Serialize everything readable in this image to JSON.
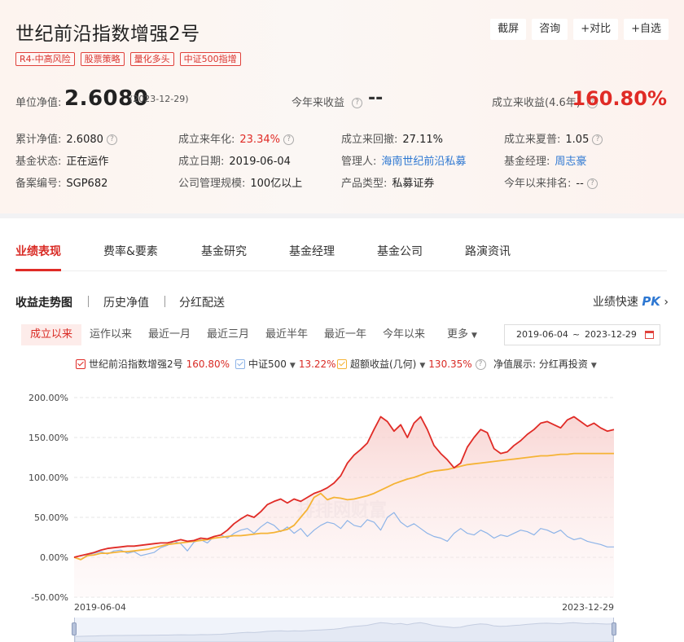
{
  "header": {
    "title": "世纪前沿指数增强2号",
    "tags": [
      "R4-中高风险",
      "股票策略",
      "量化多头",
      "中证500指增"
    ],
    "buttons": [
      "截屏",
      "咨询",
      "+对比",
      "+自选"
    ]
  },
  "summary": {
    "nav_label": "单位净值:",
    "nav_value": "2.6080",
    "nav_date": "(2023-12-29)",
    "ytd_label": "今年来收益",
    "ytd_value": "--",
    "since_label": "成立来收益(4.6年)",
    "since_value": "160.80%"
  },
  "details": {
    "row1": [
      {
        "label": "累计净值:",
        "value": "2.6080"
      },
      {
        "label": "成立来年化:",
        "value": "23.34%"
      },
      {
        "label": "成立来回撤:",
        "value": "27.11%"
      },
      {
        "label": "成立来夏普:",
        "value": "1.05"
      }
    ],
    "row2": [
      {
        "label": "基金状态:",
        "value": "正在运作"
      },
      {
        "label": "成立日期:",
        "value": "2019-06-04"
      },
      {
        "label": "管理人:",
        "value": "海南世纪前沿私募"
      },
      {
        "label": "基金经理:",
        "value": "周志豪"
      }
    ],
    "row3": [
      {
        "label": "备案编号:",
        "value": "SGP682"
      },
      {
        "label": "公司管理规模:",
        "value": "100亿以上"
      },
      {
        "label": "产品类型:",
        "value": "私募证券"
      },
      {
        "label": "今年以来排名:",
        "value": "--"
      }
    ]
  },
  "tabs": [
    "业绩表现",
    "费率&要素",
    "基金研究",
    "基金经理",
    "基金公司",
    "路演资讯"
  ],
  "subtabs": [
    "收益走势图",
    "历史净值",
    "分红配送"
  ],
  "quick_compare": {
    "label": "业绩快速",
    "pk": "PK"
  },
  "ranges": [
    "成立以来",
    "运作以来",
    "最近一月",
    "最近三月",
    "最近半年",
    "最近一年",
    "今年以来",
    "更多"
  ],
  "date_range": {
    "start": "2019-06-04",
    "sep": "~",
    "end": "2023-12-29"
  },
  "legend": {
    "items": [
      {
        "name": "世纪前沿指数增强2号",
        "value": "160.80%",
        "color": "#e02b26"
      },
      {
        "name": "中证500",
        "value": "13.22%",
        "color": "#8db4e8"
      },
      {
        "name": "超额收益(几何)",
        "value": "130.35%",
        "color": "#f5b335"
      }
    ],
    "display_label": "净值展示:",
    "display_value": "分红再投资"
  },
  "chart_data": {
    "type": "line",
    "x_start": "2019-06-04",
    "x_end": "2023-12-29",
    "x_ticks": [
      "2019-06-04",
      "2023-12-29"
    ],
    "y_ticks": [
      "200.00%",
      "150.00%",
      "100.00%",
      "50.00%",
      "0.00%",
      "-50.00%"
    ],
    "ylim": [
      -50,
      200
    ],
    "grid": true,
    "watermark": "排排网财富",
    "series": [
      {
        "name": "世纪前沿指数增强2号",
        "color": "#e02b26",
        "values": [
          0,
          2,
          4,
          6,
          9,
          11,
          12,
          13,
          14,
          14,
          15,
          16,
          17,
          18,
          18,
          20,
          22,
          20,
          21,
          24,
          23,
          26,
          28,
          34,
          42,
          48,
          53,
          50,
          57,
          66,
          70,
          73,
          68,
          73,
          70,
          75,
          80,
          83,
          87,
          93,
          102,
          118,
          128,
          135,
          143,
          160,
          176,
          170,
          158,
          166,
          150,
          168,
          176,
          160,
          140,
          130,
          122,
          112,
          118,
          138,
          150,
          160,
          156,
          136,
          130,
          132,
          140,
          146,
          154,
          160,
          168,
          170,
          166,
          162,
          172,
          176,
          170,
          164,
          168,
          162,
          158,
          160
        ]
      },
      {
        "name": "中证500",
        "color": "#8db4e8",
        "values": [
          0,
          -3,
          3,
          5,
          7,
          4,
          8,
          9,
          5,
          7,
          2,
          4,
          6,
          12,
          15,
          20,
          17,
          8,
          19,
          22,
          18,
          26,
          28,
          24,
          30,
          34,
          36,
          30,
          38,
          44,
          40,
          32,
          38,
          30,
          36,
          26,
          34,
          40,
          44,
          42,
          36,
          46,
          40,
          38,
          47,
          44,
          34,
          50,
          56,
          44,
          38,
          42,
          36,
          30,
          26,
          24,
          20,
          30,
          36,
          30,
          28,
          34,
          30,
          24,
          28,
          26,
          30,
          34,
          32,
          28,
          36,
          34,
          30,
          34,
          26,
          22,
          24,
          20,
          18,
          16,
          13,
          13
        ]
      },
      {
        "name": "超额收益(几何)",
        "color": "#f5b335",
        "values": [
          0,
          -3,
          2,
          3,
          5,
          5,
          6,
          7,
          7,
          8,
          9,
          10,
          12,
          14,
          16,
          17,
          18,
          19,
          20,
          21,
          22,
          24,
          25,
          26,
          27,
          27,
          28,
          29,
          30,
          30,
          31,
          33,
          35,
          40,
          50,
          60,
          75,
          80,
          72,
          75,
          74,
          72,
          73,
          75,
          77,
          80,
          84,
          88,
          92,
          95,
          98,
          100,
          103,
          106,
          108,
          109,
          110,
          112,
          114,
          116,
          117,
          118,
          119,
          120,
          121,
          122,
          123,
          124,
          125,
          126,
          127,
          127,
          128,
          129,
          129,
          130,
          130,
          130,
          130,
          130,
          130,
          130
        ]
      }
    ]
  }
}
